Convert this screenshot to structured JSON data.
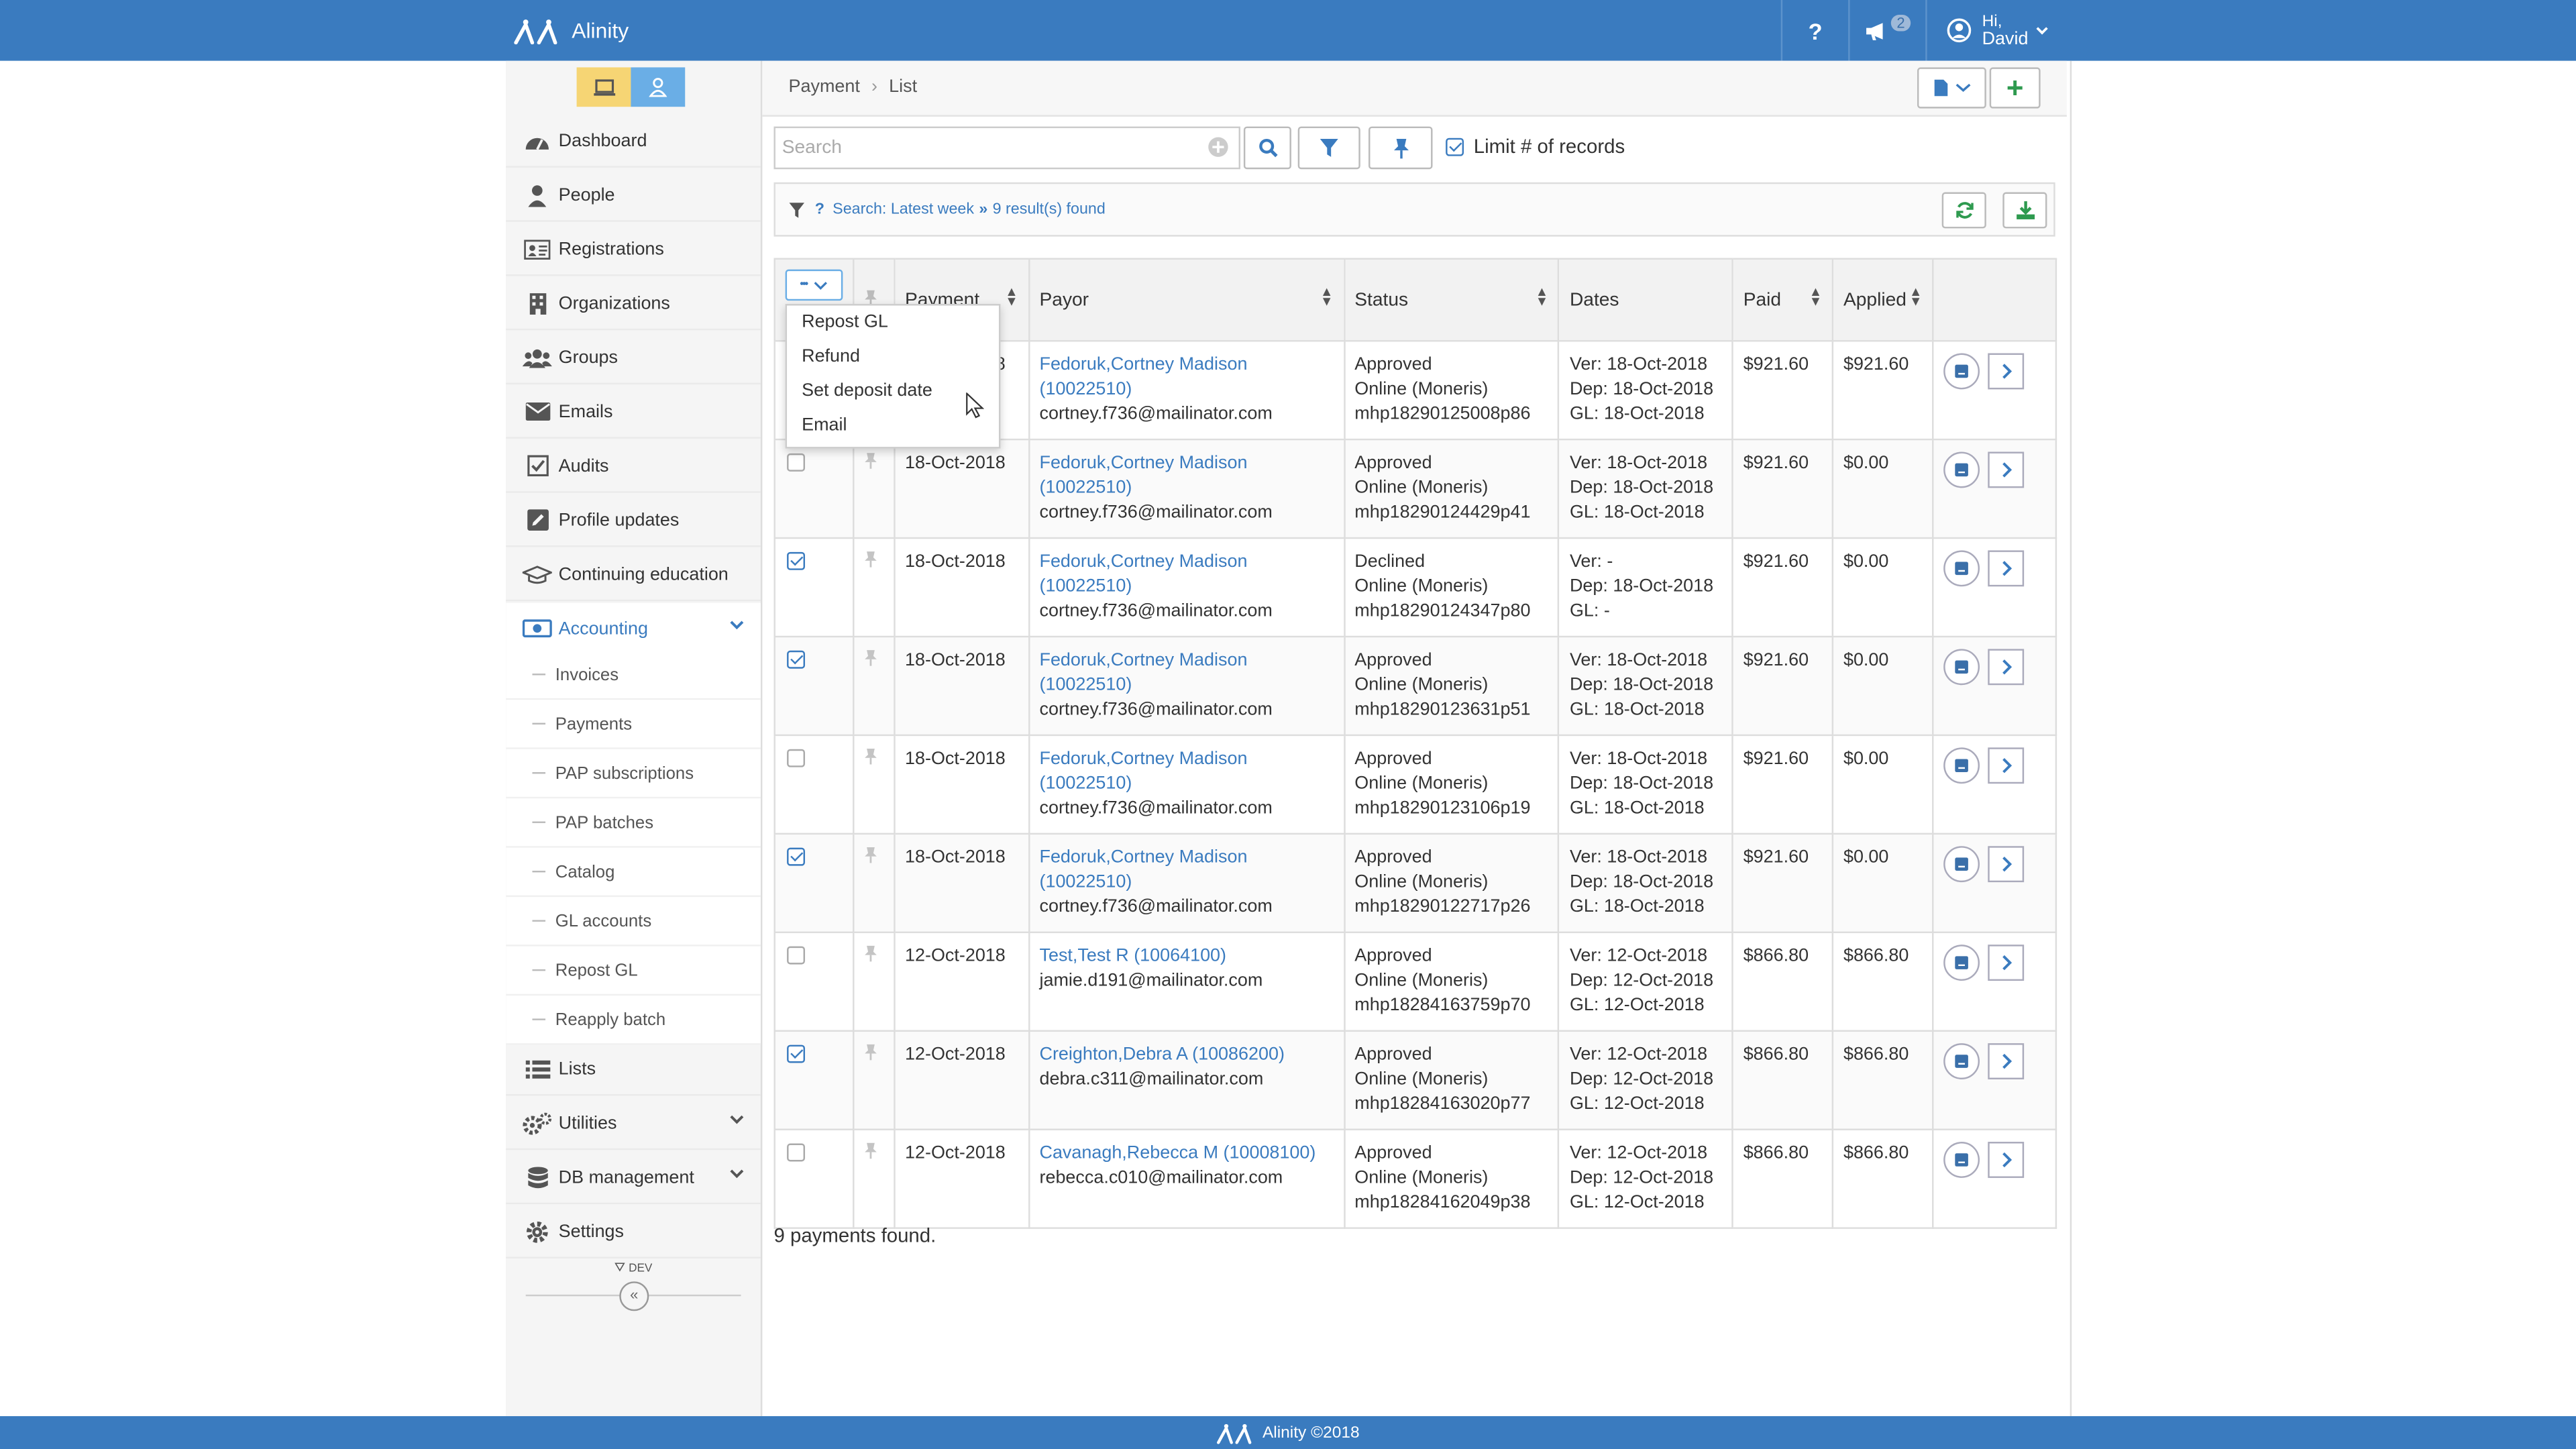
{
  "app": {
    "name": "Alinity"
  },
  "topbar": {
    "help": "?",
    "notification_count": "2",
    "user_greeting": "Hi,",
    "user_name": "David"
  },
  "breadcrumb": {
    "parent": "Payment",
    "separator": "›",
    "current": "List"
  },
  "sidebar": {
    "dev_label": "DEV",
    "collapse": "«",
    "items": [
      {
        "label": "Dashboard",
        "icon": "dashboard-icon"
      },
      {
        "label": "People",
        "icon": "person-icon"
      },
      {
        "label": "Registrations",
        "icon": "id-card-icon"
      },
      {
        "label": "Organizations",
        "icon": "building-icon"
      },
      {
        "label": "Groups",
        "icon": "users-icon"
      },
      {
        "label": "Emails",
        "icon": "envelope-icon"
      },
      {
        "label": "Audits",
        "icon": "checkbox-icon"
      },
      {
        "label": "Profile updates",
        "icon": "edit-icon"
      },
      {
        "label": "Continuing education",
        "icon": "graduation-cap-icon"
      },
      {
        "label": "Accounting",
        "icon": "money-icon"
      },
      {
        "label": "Lists",
        "icon": "list-icon"
      },
      {
        "label": "Utilities",
        "icon": "gears-icon"
      },
      {
        "label": "DB management",
        "icon": "database-icon"
      },
      {
        "label": "Settings",
        "icon": "gear-icon"
      }
    ],
    "accounting_sub": [
      "Invoices",
      "Payments",
      "PAP subscriptions",
      "PAP batches",
      "Catalog",
      "GL accounts",
      "Repost GL",
      "Reapply batch"
    ]
  },
  "search": {
    "placeholder": "Search",
    "limit_label": "Limit # of records",
    "limit_checked": true
  },
  "filter_info": {
    "search_text": "Search: Latest week",
    "arrows": "»",
    "result_text": "9 result(s) found"
  },
  "table": {
    "headers": {
      "payment": "Payment",
      "payor": "Payor",
      "status": "Status",
      "dates": "Dates",
      "paid": "Paid",
      "applied": "Applied"
    },
    "rows": [
      {
        "checked": false,
        "date": "18-Oct-2018",
        "payor_name": "Fedoruk,Cortney Madison",
        "payor_id": "(10022510)",
        "email": "cortney.f736@mailinator.com",
        "status": "Approved",
        "method": "Online (Moneris)",
        "ref": "mhp18290125008p86",
        "ver": "Ver: 18-Oct-2018",
        "dep": "Dep: 18-Oct-2018",
        "gl": "GL: 18-Oct-2018",
        "paid": "$921.60",
        "applied": "$921.60"
      },
      {
        "checked": false,
        "date": "18-Oct-2018",
        "payor_name": "Fedoruk,Cortney Madison",
        "payor_id": "(10022510)",
        "email": "cortney.f736@mailinator.com",
        "status": "Approved",
        "method": "Online (Moneris)",
        "ref": "mhp18290124429p41",
        "ver": "Ver: 18-Oct-2018",
        "dep": "Dep: 18-Oct-2018",
        "gl": "GL: 18-Oct-2018",
        "paid": "$921.60",
        "applied": "$0.00"
      },
      {
        "checked": true,
        "date": "18-Oct-2018",
        "payor_name": "Fedoruk,Cortney Madison",
        "payor_id": "(10022510)",
        "email": "cortney.f736@mailinator.com",
        "status": "Declined",
        "method": "Online (Moneris)",
        "ref": "mhp18290124347p80",
        "ver": "Ver: -",
        "dep": "Dep: 18-Oct-2018",
        "gl": "GL: -",
        "paid": "$921.60",
        "applied": "$0.00"
      },
      {
        "checked": true,
        "date": "18-Oct-2018",
        "payor_name": "Fedoruk,Cortney Madison",
        "payor_id": "(10022510)",
        "email": "cortney.f736@mailinator.com",
        "status": "Approved",
        "method": "Online (Moneris)",
        "ref": "mhp18290123631p51",
        "ver": "Ver: 18-Oct-2018",
        "dep": "Dep: 18-Oct-2018",
        "gl": "GL: 18-Oct-2018",
        "paid": "$921.60",
        "applied": "$0.00"
      },
      {
        "checked": false,
        "date": "18-Oct-2018",
        "payor_name": "Fedoruk,Cortney Madison",
        "payor_id": "(10022510)",
        "email": "cortney.f736@mailinator.com",
        "status": "Approved",
        "method": "Online (Moneris)",
        "ref": "mhp18290123106p19",
        "ver": "Ver: 18-Oct-2018",
        "dep": "Dep: 18-Oct-2018",
        "gl": "GL: 18-Oct-2018",
        "paid": "$921.60",
        "applied": "$0.00"
      },
      {
        "checked": true,
        "date": "18-Oct-2018",
        "payor_name": "Fedoruk,Cortney Madison",
        "payor_id": "(10022510)",
        "email": "cortney.f736@mailinator.com",
        "status": "Approved",
        "method": "Online (Moneris)",
        "ref": "mhp18290122717p26",
        "ver": "Ver: 18-Oct-2018",
        "dep": "Dep: 18-Oct-2018",
        "gl": "GL: 18-Oct-2018",
        "paid": "$921.60",
        "applied": "$0.00"
      },
      {
        "checked": false,
        "date": "12-Oct-2018",
        "payor_name": "Test,Test R (10064100)",
        "payor_id": "",
        "email": "jamie.d191@mailinator.com",
        "status": "Approved",
        "method": "Online (Moneris)",
        "ref": "mhp18284163759p70",
        "ver": "Ver: 12-Oct-2018",
        "dep": "Dep: 12-Oct-2018",
        "gl": "GL: 12-Oct-2018",
        "paid": "$866.80",
        "applied": "$866.80"
      },
      {
        "checked": true,
        "date": "12-Oct-2018",
        "payor_name": "Creighton,Debra A (10086200)",
        "payor_id": "",
        "email": "debra.c311@mailinator.com",
        "status": "Approved",
        "method": "Online (Moneris)",
        "ref": "mhp18284163020p77",
        "ver": "Ver: 12-Oct-2018",
        "dep": "Dep: 12-Oct-2018",
        "gl": "GL: 12-Oct-2018",
        "paid": "$866.80",
        "applied": "$866.80"
      },
      {
        "checked": false,
        "date": "12-Oct-2018",
        "payor_name": "Cavanagh,Rebecca M (10008100)",
        "payor_id": "",
        "email": "rebecca.c010@mailinator.com",
        "status": "Approved",
        "method": "Online (Moneris)",
        "ref": "mhp18284162049p38",
        "ver": "Ver: 12-Oct-2018",
        "dep": "Dep: 12-Oct-2018",
        "gl": "GL: 12-Oct-2018",
        "paid": "$866.80",
        "applied": "$866.80"
      }
    ]
  },
  "bulk_menu": {
    "toggle": "•••",
    "items": [
      "Repost GL",
      "Refund",
      "Set deposit date",
      "Email"
    ]
  },
  "footer_text": "9 payments found.",
  "copyright": "Alinity ©2018",
  "colors": {
    "brand": "#3a7bbf",
    "accent_yellow": "#f6d574",
    "accent_blue": "#6aaee6"
  }
}
